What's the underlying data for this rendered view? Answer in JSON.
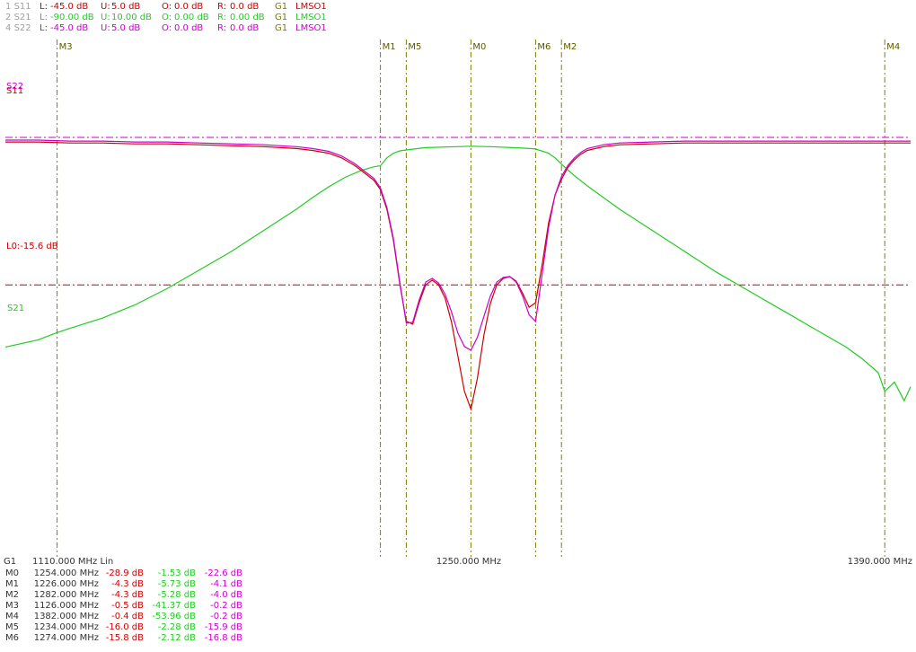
{
  "colors": {
    "s11": "#cc0000",
    "s21": "#22cc22",
    "s22": "#cc00cc",
    "marker": "#808000",
    "text_dark": "#333333"
  },
  "header": {
    "rows": [
      {
        "id": "1",
        "trace": "S11",
        "L": "-45.0 dB",
        "U": "5.0 dB",
        "O": "0.0 dB",
        "R": "0.0 dB",
        "G": "G1",
        "cal": "LMSO1",
        "color": "#cc0000"
      },
      {
        "id": "2",
        "trace": "S21",
        "L": "-90.00 dB",
        "U": "10.00 dB",
        "O": "0.00 dB",
        "R": "0.00 dB",
        "G": "G1",
        "cal": "LMSO1",
        "color": "#22cc22"
      },
      {
        "id": "4",
        "trace": "S22",
        "L": "-45.0 dB",
        "U": "5.0 dB",
        "O": "0.0 dB",
        "R": "0.0 dB",
        "G": "G1",
        "cal": "LMSO1",
        "color": "#cc00cc"
      }
    ],
    "labels": {
      "L": "L:",
      "U": "U:",
      "O": "O:",
      "R": "R:"
    }
  },
  "footer": {
    "group": "G1",
    "start": "1110.000 MHz Lin",
    "center": "1250.000 MHz",
    "stop": "1390.000 MHz"
  },
  "trace_labels": {
    "s21": "S21",
    "s11": "S11",
    "s22": "S22",
    "limit": "L0:-15.6 dB"
  },
  "marker_table": [
    {
      "name": "M0",
      "freq": "1254.000 MHz",
      "s11": "-28.9 dB",
      "s21": "-1.53 dB",
      "s22": "-22.6 dB"
    },
    {
      "name": "M1",
      "freq": "1226.000 MHz",
      "s11": "-4.3 dB",
      "s21": "-5.73 dB",
      "s22": "-4.1 dB"
    },
    {
      "name": "M2",
      "freq": "1282.000 MHz",
      "s11": "-4.3 dB",
      "s21": "-5.28 dB",
      "s22": "-4.0 dB"
    },
    {
      "name": "M3",
      "freq": "1126.000 MHz",
      "s11": "-0.5 dB",
      "s21": "-41.37 dB",
      "s22": "-0.2 dB"
    },
    {
      "name": "M4",
      "freq": "1382.000 MHz",
      "s11": "-0.4 dB",
      "s21": "-53.96 dB",
      "s22": "-0.2 dB"
    },
    {
      "name": "M5",
      "freq": "1234.000 MHz",
      "s11": "-16.0 dB",
      "s21": "-2.28 dB",
      "s22": "-15.9 dB"
    },
    {
      "name": "M6",
      "freq": "1274.000 MHz",
      "s11": "-15.8 dB",
      "s21": "-2.12 dB",
      "s22": "-16.8 dB"
    }
  ],
  "chart_data": {
    "type": "line",
    "xlim": [
      1110,
      1390
    ],
    "markers": [
      {
        "name": "M3",
        "x": 1126
      },
      {
        "name": "M1",
        "x": 1226
      },
      {
        "name": "M5",
        "x": 1234
      },
      {
        "name": "M0",
        "x": 1254
      },
      {
        "name": "M6",
        "x": 1274
      },
      {
        "name": "M2",
        "x": 1282
      },
      {
        "name": "M4",
        "x": 1382
      }
    ],
    "limit_line": {
      "value": -15.6
    },
    "series": [
      {
        "name": "S11",
        "color": "#cc0000",
        "ylim": [
          -45,
          5
        ],
        "x": [
          1110,
          1120,
          1130,
          1140,
          1150,
          1160,
          1170,
          1180,
          1190,
          1200,
          1205,
          1210,
          1214,
          1218,
          1221,
          1224,
          1226,
          1228,
          1230,
          1232,
          1234,
          1236,
          1238,
          1240,
          1242,
          1244,
          1246,
          1248,
          1250,
          1252,
          1254,
          1256,
          1258,
          1260,
          1262,
          1264,
          1266,
          1268,
          1270,
          1272,
          1274,
          1276,
          1278,
          1280,
          1282,
          1284,
          1286,
          1288,
          1290,
          1295,
          1300,
          1310,
          1320,
          1340,
          1360,
          1382,
          1390
        ],
        "y": [
          -0.3,
          -0.3,
          -0.4,
          -0.4,
          -0.5,
          -0.5,
          -0.6,
          -0.7,
          -0.8,
          -1.0,
          -1.2,
          -1.5,
          -2.0,
          -2.8,
          -3.6,
          -4.4,
          -5.4,
          -7.5,
          -10.8,
          -15.5,
          -19.5,
          -19.8,
          -17.5,
          -15.6,
          -15.1,
          -15.6,
          -17.0,
          -19.6,
          -23.3,
          -27.0,
          -28.9,
          -25.6,
          -21.0,
          -17.6,
          -15.6,
          -14.9,
          -14.7,
          -15.2,
          -16.5,
          -18.0,
          -17.5,
          -13.5,
          -9.0,
          -6.0,
          -4.3,
          -3.0,
          -2.2,
          -1.6,
          -1.2,
          -0.8,
          -0.6,
          -0.5,
          -0.4,
          -0.4,
          -0.4,
          -0.4,
          -0.4
        ]
      },
      {
        "name": "S22",
        "color": "#cc00cc",
        "ylim": [
          -45,
          5
        ],
        "x": [
          1110,
          1120,
          1130,
          1140,
          1150,
          1160,
          1170,
          1180,
          1190,
          1200,
          1205,
          1210,
          1214,
          1218,
          1221,
          1224,
          1226,
          1228,
          1230,
          1232,
          1234,
          1236,
          1238,
          1240,
          1242,
          1244,
          1246,
          1248,
          1250,
          1252,
          1254,
          1256,
          1258,
          1260,
          1262,
          1264,
          1266,
          1268,
          1270,
          1272,
          1274,
          1276,
          1278,
          1280,
          1282,
          1284,
          1286,
          1288,
          1290,
          1295,
          1300,
          1310,
          1320,
          1340,
          1360,
          1382,
          1390
        ],
        "y": [
          -0.1,
          -0.1,
          -0.2,
          -0.2,
          -0.3,
          -0.3,
          -0.4,
          -0.5,
          -0.6,
          -0.8,
          -1.0,
          -1.3,
          -1.8,
          -2.6,
          -3.4,
          -4.2,
          -5.2,
          -7.3,
          -10.6,
          -15.3,
          -19.7,
          -19.6,
          -17.2,
          -15.3,
          -14.9,
          -15.4,
          -16.6,
          -18.5,
          -20.8,
          -22.2,
          -22.6,
          -21.2,
          -19.0,
          -16.8,
          -15.3,
          -14.8,
          -14.7,
          -15.3,
          -16.8,
          -18.8,
          -19.5,
          -14.5,
          -9.5,
          -6.0,
          -4.0,
          -2.8,
          -2.0,
          -1.4,
          -1.0,
          -0.6,
          -0.4,
          -0.3,
          -0.2,
          -0.2,
          -0.2,
          -0.2,
          -0.2
        ]
      },
      {
        "name": "S21",
        "color": "#22cc22",
        "ylim": [
          -90,
          10
        ],
        "x": [
          1110,
          1120,
          1126,
          1130,
          1140,
          1150,
          1160,
          1170,
          1180,
          1190,
          1200,
          1205,
          1210,
          1215,
          1220,
          1224,
          1226,
          1228,
          1230,
          1232,
          1234,
          1240,
          1250,
          1254,
          1260,
          1270,
          1274,
          1278,
          1280,
          1282,
          1284,
          1286,
          1290,
          1300,
          1310,
          1320,
          1330,
          1340,
          1350,
          1360,
          1370,
          1375,
          1380,
          1382,
          1385,
          1388,
          1390
        ],
        "y": [
          -44.5,
          -43.0,
          -41.4,
          -40.5,
          -38.3,
          -35.5,
          -32.0,
          -28.0,
          -24.0,
          -19.5,
          -15.0,
          -12.5,
          -10.2,
          -8.2,
          -6.7,
          -5.9,
          -5.7,
          -4.0,
          -3.0,
          -2.5,
          -2.3,
          -1.8,
          -1.6,
          -1.5,
          -1.6,
          -1.9,
          -2.1,
          -3.0,
          -4.0,
          -5.3,
          -6.6,
          -7.8,
          -10.0,
          -15.0,
          -19.5,
          -24.0,
          -28.5,
          -32.5,
          -36.5,
          -40.5,
          -44.5,
          -47.0,
          -50.0,
          -54.0,
          -52.0,
          -56.0,
          -53.0
        ]
      }
    ]
  }
}
